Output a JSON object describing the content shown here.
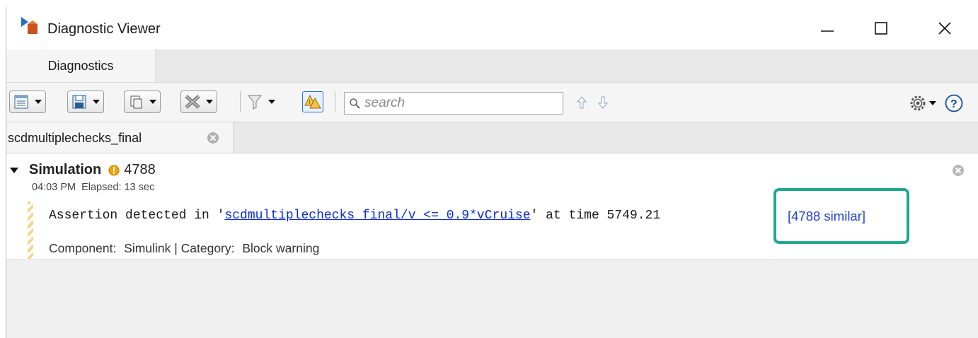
{
  "window": {
    "title": "Diagnostic Viewer"
  },
  "ribbon": {
    "tab_label": "Diagnostics"
  },
  "toolbar": {
    "buttons": [
      "view-options",
      "save",
      "copy",
      "clear"
    ],
    "search_placeholder": "search"
  },
  "model_tab": {
    "label": "scdmultiplechecks_final"
  },
  "diagnostic": {
    "title": "Simulation",
    "warning_count": "4788",
    "time": "04:03 PM",
    "elapsed": "Elapsed: 13 sec",
    "message_prefix": "Assertion detected in '",
    "message_link": "scdmultiplechecks final/v <= 0.9*vCruise",
    "message_suffix": "' at time 5749.21",
    "similar_link": "[4788 similar]",
    "component": "Component:",
    "component_value": "Simulink | Category:",
    "category_value": "Block warning"
  },
  "colors": {
    "highlight": "#20a88f",
    "link": "#0b2bd8",
    "warning": "#f0a500"
  }
}
